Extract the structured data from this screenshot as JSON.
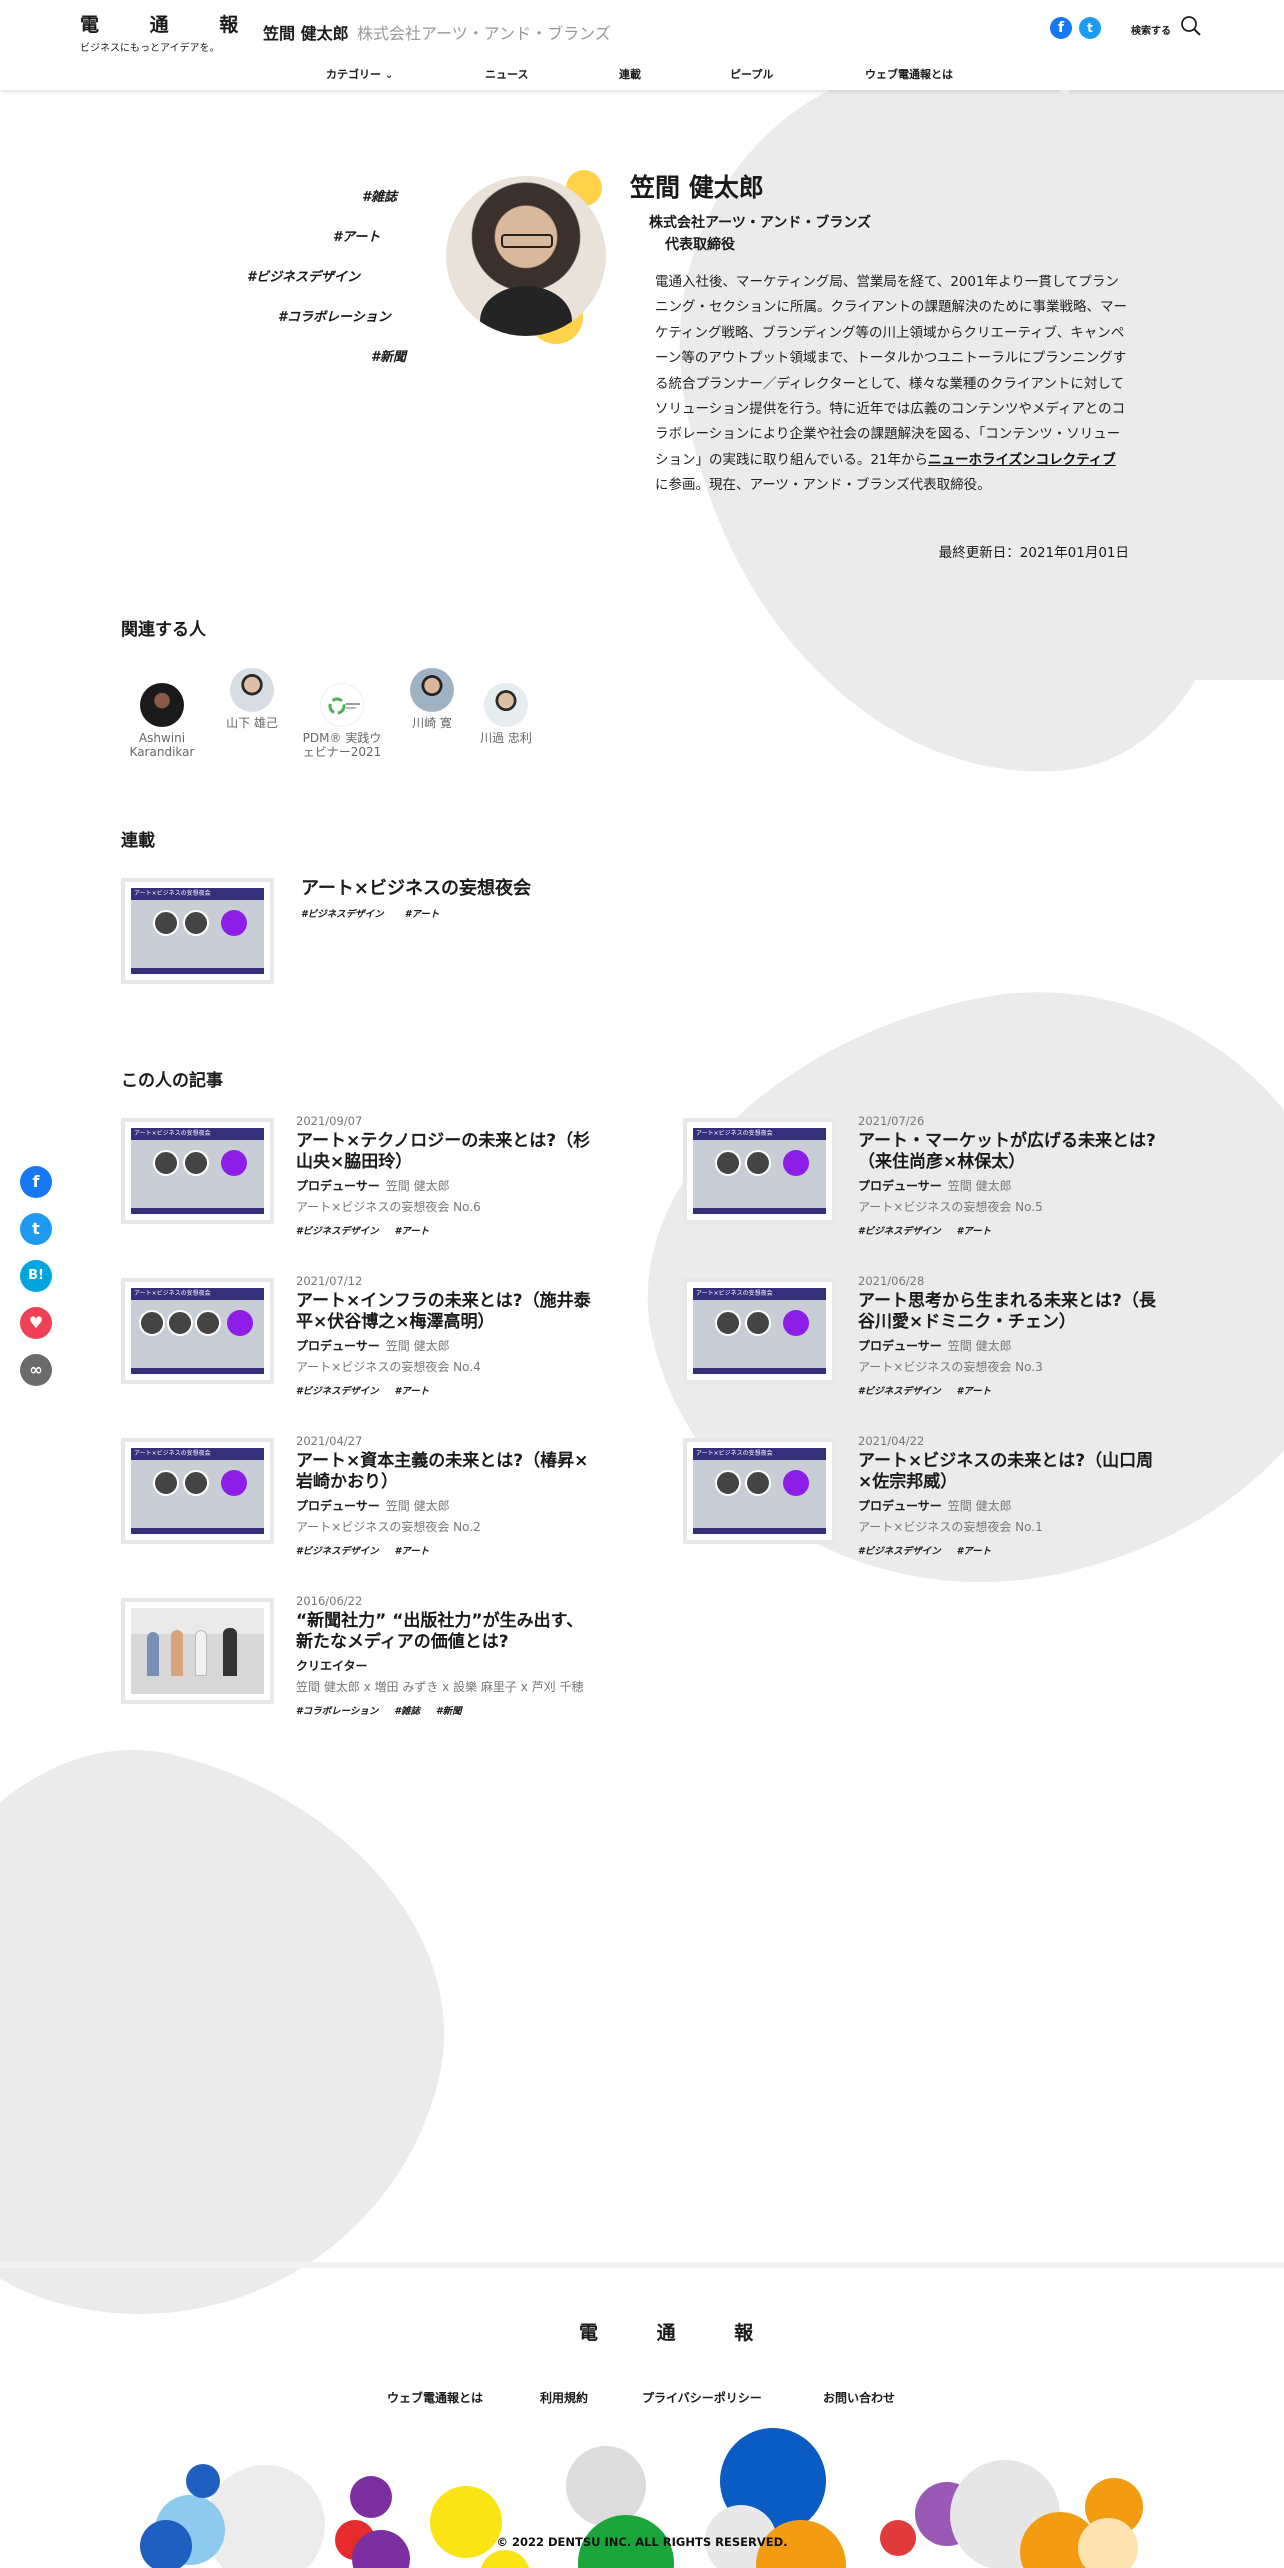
{
  "header": {
    "logo": "電 通 報",
    "logo_tagline": "ビジネスにもっとアイデアを。",
    "person_name": "笠間 健太郎",
    "company": "株式会社アーツ・アンド・ブランズ",
    "search_label": "検索する",
    "nav": [
      "カテゴリー",
      "ニュース",
      "連載",
      "ピープル",
      "ウェブ電通報とは"
    ]
  },
  "profile": {
    "name": "笠間 健太郎",
    "company": "株式会社アーツ・アンド・ブランズ",
    "title": "代表取締役",
    "tags": [
      "#雑誌",
      "#アート",
      "#ビジネスデザイン",
      "#コラボレーション",
      "#新聞"
    ],
    "bio_before": "電通入社後、マーケティング局、営業局を経て、2001年より一貫してプランニング・セクションに所属。クライアントの課題解決のために事業戦略、マーケティング戦略、ブランディング等の川上領域からクリエーティブ、キャンペーン等のアウトプット領域まで、トータルかつユニトーラルにプランニングする統合プランナー／ディレクターとして、様々な業種のクライアントに対してソリューション提供を行う。特に近年では広義のコンテンツやメディアとのコラボレーションにより企業や社会の課題解決を図る、「コンテンツ・ソリューション」の実践に取り組んでいる。21年から",
    "bio_link": "ニューホライズンコレクティブ",
    "bio_after": "に参画。現在、アーツ・アンド・ブランズ代表取締役。",
    "updated": "最終更新日：2021年01月01日"
  },
  "related": {
    "heading": "関連する人",
    "people": [
      {
        "name": "Ashwini Karandikar"
      },
      {
        "name": "山下 雄己"
      },
      {
        "name": "PDM® 実践ウェビナー2021"
      },
      {
        "name": "川崎 寛"
      },
      {
        "name": "川過 忠利"
      }
    ]
  },
  "serial": {
    "heading": "連載",
    "title": "アート×ビジネスの妄想夜会",
    "thumb_text": "アート×ビジネスの妄想夜会",
    "tags": [
      "#ビジネスデザイン",
      "#アート"
    ]
  },
  "articles": {
    "heading": "この人の記事",
    "items": [
      {
        "date": "2021/09/07",
        "title": "アート×テクノロジーの未来とは?（杉山央×脇田玲）",
        "role": "プロデューサー",
        "person": "笠間 健太郎",
        "series": "アート×ビジネスの妄想夜会 No.6",
        "tags": [
          "#ビジネスデザイン",
          "#アート"
        ]
      },
      {
        "date": "2021/07/26",
        "title": "アート・マーケットが広げる未来とは?（来住尚彦×林保太）",
        "role": "プロデューサー",
        "person": "笠間 健太郎",
        "series": "アート×ビジネスの妄想夜会 No.5",
        "tags": [
          "#ビジネスデザイン",
          "#アート"
        ]
      },
      {
        "date": "2021/07/12",
        "title": "アート×インフラの未来とは?（施井泰平×伏谷博之×梅澤高明）",
        "role": "プロデューサー",
        "person": "笠間 健太郎",
        "series": "アート×ビジネスの妄想夜会 No.4",
        "tags": [
          "#ビジネスデザイン",
          "#アート"
        ]
      },
      {
        "date": "2021/06/28",
        "title": "アート思考から生まれる未来とは?（長谷川愛×ドミニク・チェン）",
        "role": "プロデューサー",
        "person": "笠間 健太郎",
        "series": "アート×ビジネスの妄想夜会 No.3",
        "tags": [
          "#ビジネスデザイン",
          "#アート"
        ]
      },
      {
        "date": "2021/04/27",
        "title": "アート×資本主義の未来とは?（椿昇×岩崎かおり）",
        "role": "プロデューサー",
        "person": "笠間 健太郎",
        "series": "アート×ビジネスの妄想夜会 No.2",
        "tags": [
          "#ビジネスデザイン",
          "#アート"
        ]
      },
      {
        "date": "2021/04/22",
        "title": "アート×ビジネスの未来とは?（山口周×佐宗邦威）",
        "role": "プロデューサー",
        "person": "笠間 健太郎",
        "series": "アート×ビジネスの妄想夜会 No.1",
        "tags": [
          "#ビジネスデザイン",
          "#アート"
        ]
      },
      {
        "date": "2016/06/22",
        "title": "“新聞社力” “出版社力”が生み出す、新たなメディアの価値とは?",
        "role": "クリエイター",
        "person": "",
        "series": "笠間 健太郎 x 増田 みずき x 設樂 麻里子 x 芦刈 千穂",
        "tags": [
          "#コラボレーション",
          "#雑誌",
          "#新聞"
        ]
      }
    ]
  },
  "share": [
    {
      "icon": "facebook-icon",
      "glyph": "f",
      "color": "#1877f2"
    },
    {
      "icon": "twitter-icon",
      "glyph": "t",
      "color": "#1d9bf0"
    },
    {
      "icon": "hatena-bookmark-icon",
      "glyph": "B!",
      "color": "#00a4de"
    },
    {
      "icon": "pocket-icon",
      "glyph": "♥",
      "color": "#ef4056"
    },
    {
      "icon": "link-icon",
      "glyph": "∞",
      "color": "#6b6b6b"
    }
  ],
  "footer": {
    "logo": "電 通 報",
    "links": [
      "ウェブ電通報とは",
      "利用規約",
      "プライバシーポリシー",
      "お問い合わせ"
    ],
    "copyright": "© 2022 DENTSU INC. ALL RIGHTS RESERVED."
  },
  "colors": {
    "accent_yellow": "#ffd24a",
    "facebook": "#1877f2",
    "twitter": "#1d9bf0",
    "background_blob": "#ebebeb"
  }
}
